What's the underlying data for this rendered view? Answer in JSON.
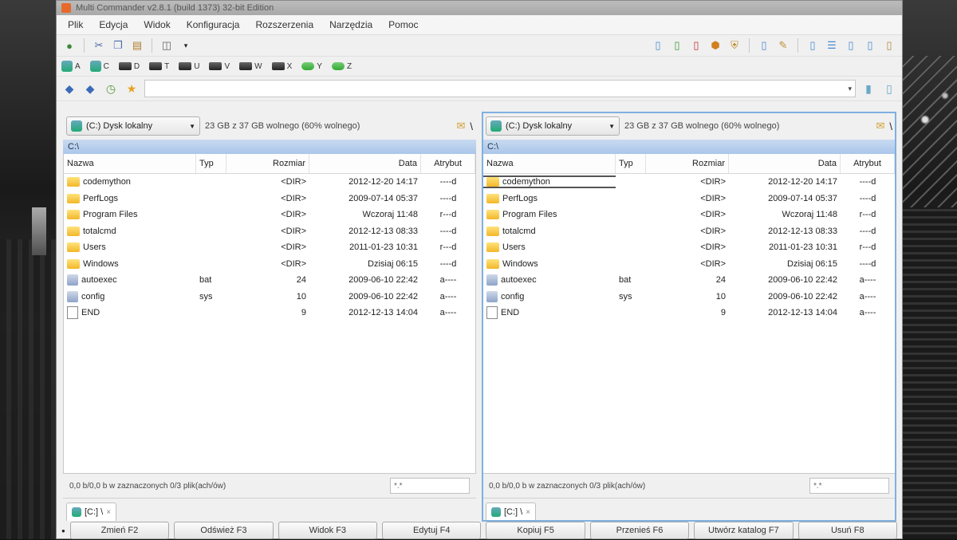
{
  "window": {
    "title": "Multi Commander v2.8.1 (build 1373) 32-bit Edition"
  },
  "menu": [
    "Plik",
    "Edycja",
    "Widok",
    "Konfiguracja",
    "Rozszerzenia",
    "Narzędzia",
    "Pomoc"
  ],
  "drives": [
    {
      "letter": "A",
      "type": "floppy"
    },
    {
      "letter": "C",
      "type": "system"
    },
    {
      "letter": "D",
      "type": "disk"
    },
    {
      "letter": "T",
      "type": "disk"
    },
    {
      "letter": "U",
      "type": "disk"
    },
    {
      "letter": "V",
      "type": "disk"
    },
    {
      "letter": "W",
      "type": "disk"
    },
    {
      "letter": "X",
      "type": "disk"
    },
    {
      "letter": "Y",
      "type": "network"
    },
    {
      "letter": "Z",
      "type": "network"
    }
  ],
  "left": {
    "drive_label": "(C:) Dysk lokalny",
    "free": "23 GB z 37 GB wolnego (60% wolnego)",
    "path": "C:\\",
    "columns": {
      "name": "Nazwa",
      "ext": "Typ",
      "size": "Rozmiar",
      "date": "Data",
      "attr": "Atrybut"
    },
    "rows": [
      {
        "name": "codemython",
        "ext": "",
        "size": "<DIR>",
        "date": "2012-12-20 14:17",
        "attr": "----d",
        "icon": "folder"
      },
      {
        "name": "PerfLogs",
        "ext": "",
        "size": "<DIR>",
        "date": "2009-07-14 05:37",
        "attr": "----d",
        "icon": "folder"
      },
      {
        "name": "Program Files",
        "ext": "",
        "size": "<DIR>",
        "date": "Wczoraj 11:48",
        "attr": "r---d",
        "icon": "folder"
      },
      {
        "name": "totalcmd",
        "ext": "",
        "size": "<DIR>",
        "date": "2012-12-13 08:33",
        "attr": "----d",
        "icon": "folder"
      },
      {
        "name": "Users",
        "ext": "",
        "size": "<DIR>",
        "date": "2011-01-23 10:31",
        "attr": "r---d",
        "icon": "folder"
      },
      {
        "name": "Windows",
        "ext": "",
        "size": "<DIR>",
        "date": "Dzisiaj 06:15",
        "attr": "----d",
        "icon": "folder"
      },
      {
        "name": "autoexec",
        "ext": "bat",
        "size": "24",
        "date": "2009-06-10 22:42",
        "attr": "a----",
        "icon": "bat"
      },
      {
        "name": "config",
        "ext": "sys",
        "size": "10",
        "date": "2009-06-10 22:42",
        "attr": "a----",
        "icon": "bat"
      },
      {
        "name": "END",
        "ext": "",
        "size": "9",
        "date": "2012-12-13 14:04",
        "attr": "a----",
        "icon": "file"
      }
    ],
    "status": "0,0 b/0,0 b w zaznaczonych 0/3 plik(ach/ów)",
    "filter": "*.*",
    "tab": "[C:] \\"
  },
  "right": {
    "drive_label": "(C:) Dysk lokalny",
    "free": "23 GB z 37 GB wolnego (60% wolnego)",
    "path": "C:\\",
    "columns": {
      "name": "Nazwa",
      "ext": "Typ",
      "size": "Rozmiar",
      "date": "Data",
      "attr": "Atrybut"
    },
    "rows": [
      {
        "name": "codemython",
        "ext": "",
        "size": "<DIR>",
        "date": "2012-12-20 14:17",
        "attr": "----d",
        "icon": "folder"
      },
      {
        "name": "PerfLogs",
        "ext": "",
        "size": "<DIR>",
        "date": "2009-07-14 05:37",
        "attr": "----d",
        "icon": "folder"
      },
      {
        "name": "Program Files",
        "ext": "",
        "size": "<DIR>",
        "date": "Wczoraj 11:48",
        "attr": "r---d",
        "icon": "folder"
      },
      {
        "name": "totalcmd",
        "ext": "",
        "size": "<DIR>",
        "date": "2012-12-13 08:33",
        "attr": "----d",
        "icon": "folder"
      },
      {
        "name": "Users",
        "ext": "",
        "size": "<DIR>",
        "date": "2011-01-23 10:31",
        "attr": "r---d",
        "icon": "folder"
      },
      {
        "name": "Windows",
        "ext": "",
        "size": "<DIR>",
        "date": "Dzisiaj 06:15",
        "attr": "----d",
        "icon": "folder"
      },
      {
        "name": "autoexec",
        "ext": "bat",
        "size": "24",
        "date": "2009-06-10 22:42",
        "attr": "a----",
        "icon": "bat"
      },
      {
        "name": "config",
        "ext": "sys",
        "size": "10",
        "date": "2009-06-10 22:42",
        "attr": "a----",
        "icon": "bat"
      },
      {
        "name": "END",
        "ext": "",
        "size": "9",
        "date": "2012-12-13 14:04",
        "attr": "a----",
        "icon": "file"
      }
    ],
    "status": "0,0 b/0,0 b w zaznaczonych 0/3 plik(ach/ów)",
    "filter": "*.*",
    "tab": "[C:] \\"
  },
  "commands": [
    "Zmień F2",
    "Odśwież F3",
    "Widok F3",
    "Edytuj F4",
    "Kopiuj F5",
    "Przenieś F6",
    "Utwórz katalog F7",
    "Usuń F8"
  ]
}
